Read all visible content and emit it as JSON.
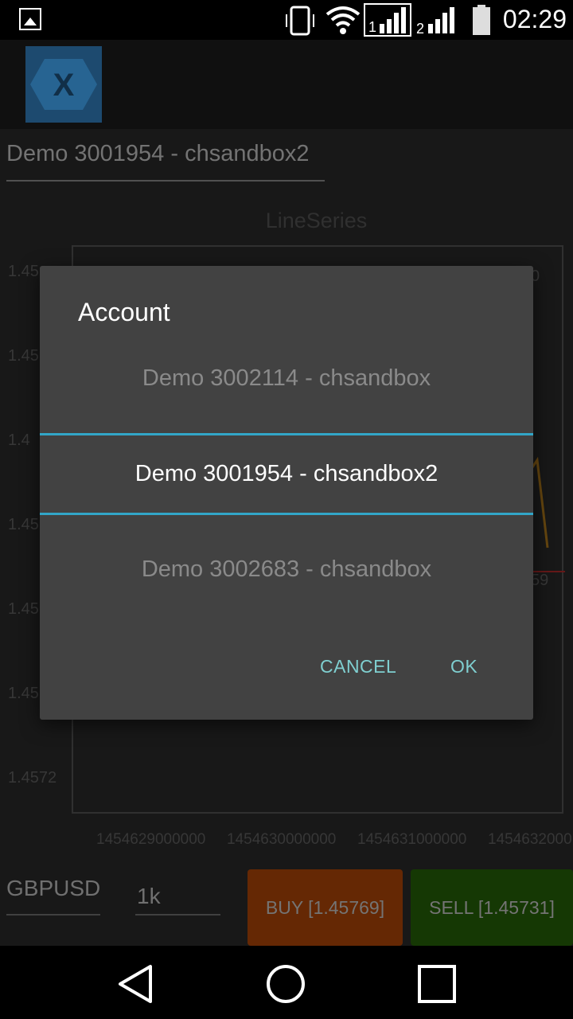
{
  "status_bar": {
    "time": "02:29",
    "icons": [
      "image-icon",
      "vibrate-icon",
      "wifi-icon",
      "signal-sim1-icon",
      "signal-sim2-icon",
      "battery-icon"
    ]
  },
  "header": {
    "logo_letter": "X"
  },
  "account_selector": {
    "value": "Demo 3001954 - chsandbox2"
  },
  "chart": {
    "title": "LineSeries",
    "y_ticks_visible": [
      "1.45",
      "1.45",
      "1.4",
      "1.45",
      "1.45",
      "1.45",
      "1.4572"
    ],
    "x_ticks": [
      "1454629000000",
      "1454630000000",
      "1454631000000",
      "1454632000"
    ],
    "right_fragments": [
      "0",
      "59"
    ]
  },
  "bottom": {
    "symbol": "GBPUSD",
    "quantity": "1k",
    "buy_label": "BUY [1.45769]",
    "sell_label": "SELL [1.45731]"
  },
  "dialog": {
    "title": "Account",
    "options": [
      "Demo 3002114 - chsandbox",
      "Demo 3001954 - chsandbox2",
      "Demo 3002683 - chsandbox"
    ],
    "selected_index": 1,
    "cancel_label": "CANCEL",
    "ok_label": "OK",
    "accent_color": "#32a6c8"
  },
  "colors": {
    "buy": "#6b2b05",
    "sell": "#173b05",
    "series": "#b5730c",
    "dialog_button": "#7fcfd0"
  }
}
